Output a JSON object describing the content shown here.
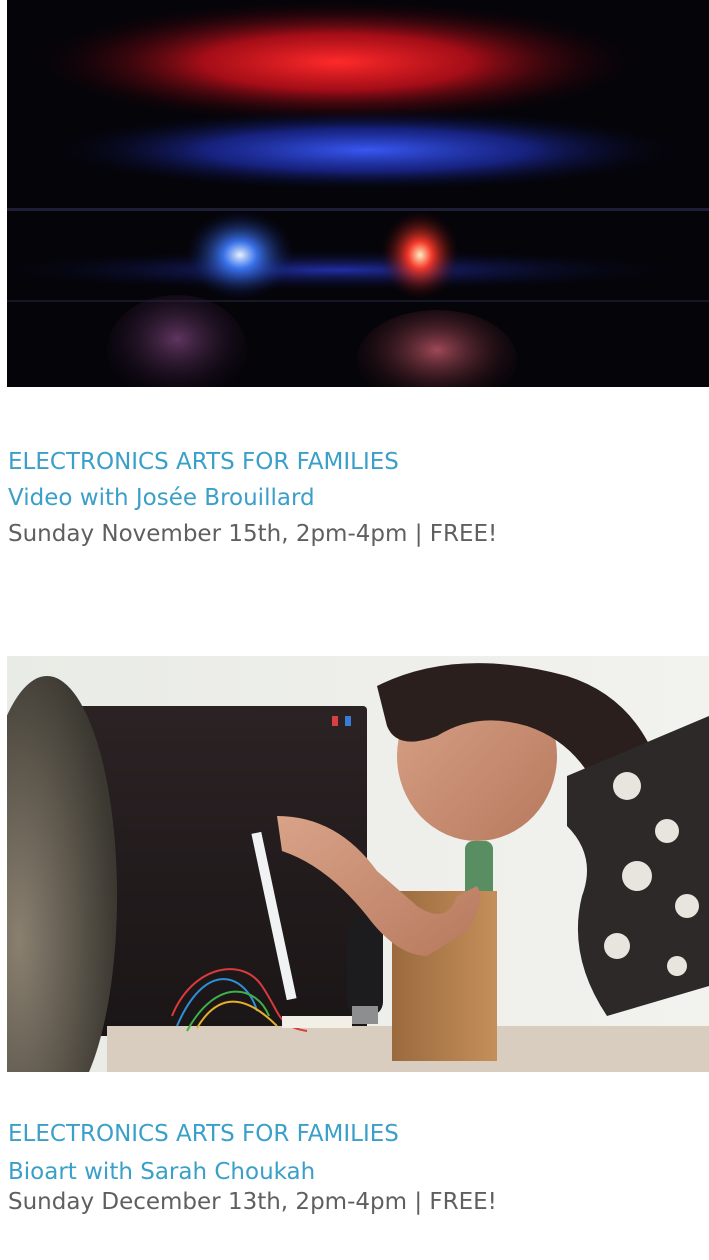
{
  "events": [
    {
      "category": "ELECTRONICS ARTS FOR FAMILIES",
      "title": "Video with Josée Brouillard",
      "details": "Sunday November 15th, 2pm-4pm | FREE!"
    },
    {
      "category": "ELECTRONICS ARTS FOR FAMILIES",
      "title": "Bioart with Sarah Choukah",
      "details": "Sunday December 13th, 2pm-4pm | FREE!"
    }
  ],
  "colors": {
    "link": "#3a9fc9",
    "text": "#5f5f5f",
    "background": "#ffffff"
  }
}
